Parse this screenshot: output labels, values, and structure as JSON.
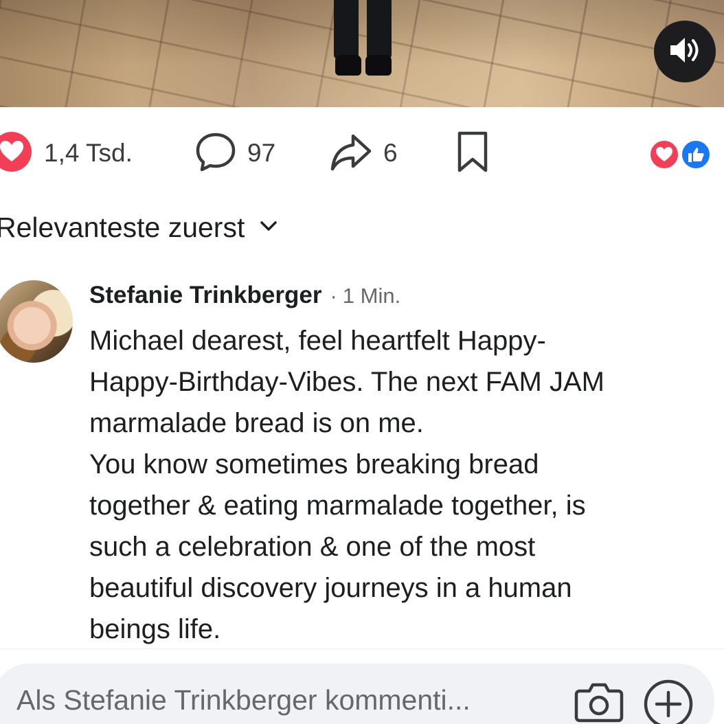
{
  "post": {
    "sound_icon": "speaker-icon",
    "stats": {
      "reactions_count": "1,4 Tsd.",
      "comments_count": "97",
      "shares_count": "6"
    },
    "reaction_icons": [
      "heart-reaction-icon",
      "like-reaction-icon"
    ]
  },
  "comments": {
    "sort_label": "Relevanteste zuerst",
    "items": [
      {
        "author": "Stefanie Trinkberger",
        "separator": "·",
        "time": "1 Min.",
        "lines": [
          "Michael dearest, feel heartfelt Happy-",
          "Happy-Birthday-Vibes. The next FAM JAM",
          "marmalade bread is on me.",
          "You know sometimes breaking bread",
          "together & eating marmalade together, is",
          "such a celebration & one of the most",
          "beautiful discovery journeys in a human",
          "beings life."
        ]
      }
    ]
  },
  "composer": {
    "placeholder": "Als Stefanie Trinkberger kommenti..."
  },
  "colors": {
    "heart": "#f33e58",
    "like": "#1877f2",
    "text": "#1c1e21",
    "secondary": "#65676b",
    "composer_bg": "#f0f2f5"
  }
}
